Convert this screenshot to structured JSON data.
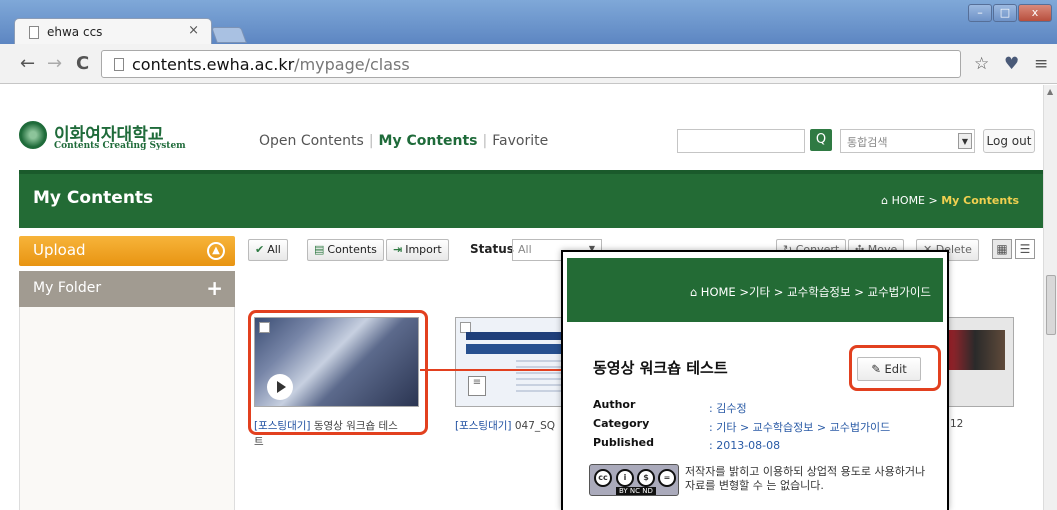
{
  "browser": {
    "tab_title": "ehwa ccs",
    "tab_close": "×",
    "url_host": "contents.ewha.ac.kr",
    "url_path": "/mypage/class",
    "back": "←",
    "forward": "→",
    "reload": "C",
    "star": "☆",
    "pocket": "♥",
    "menu": "≡",
    "win_min": "–",
    "win_max": "□",
    "win_close": "x"
  },
  "site": {
    "logo_kor": "이화여자대학교",
    "logo_eng": "Contents Creating System",
    "nav": [
      "Open Contents",
      "My Contents",
      "Favorite"
    ],
    "nav_sep": "|",
    "search_icon": "Q",
    "search_combo": "통합검색",
    "logout": "Log out"
  },
  "banner": {
    "title": "My Contents",
    "home": "HOME",
    "current": "My Contents"
  },
  "sidebar": {
    "upload": "Upload",
    "my_folder": "My Folder",
    "plus": "+"
  },
  "toolbar": {
    "all": "All",
    "contents": "Contents",
    "import": "Import",
    "status_label": "Status",
    "status_value": "All",
    "convert": "Convert",
    "move": "Move",
    "delete": "Delete"
  },
  "items": [
    {
      "tag": "[포스팅대기]",
      "title": "동영상 워크숍 테스",
      "title_wrap": "트"
    },
    {
      "tag": "[포스팅대기]",
      "title": "047_SQ"
    },
    {
      "title_tail": "12"
    }
  ],
  "popup": {
    "home": "HOME",
    "crumb": ">기타 > 교수학습정보 > 교수법가이드",
    "title": "동영상 워크숍 테스트",
    "edit": "Edit",
    "author_label": "Author",
    "author": ": 김수정",
    "category_label": "Category",
    "category": ": 기타 > 교수학습정보 > 교수법가이드",
    "published_label": "Published",
    "published": ": 2013-08-08",
    "cc_tags": "BY  NC  ND",
    "license": "저작자를 밝히고 이용하되 상업적 용도로 사용하거나 자료를 변형할 수 는 없습니다."
  },
  "colors": {
    "brand_green": "#236b35",
    "upload_orange": "#f0a42a",
    "highlight_red": "#e2401f"
  }
}
